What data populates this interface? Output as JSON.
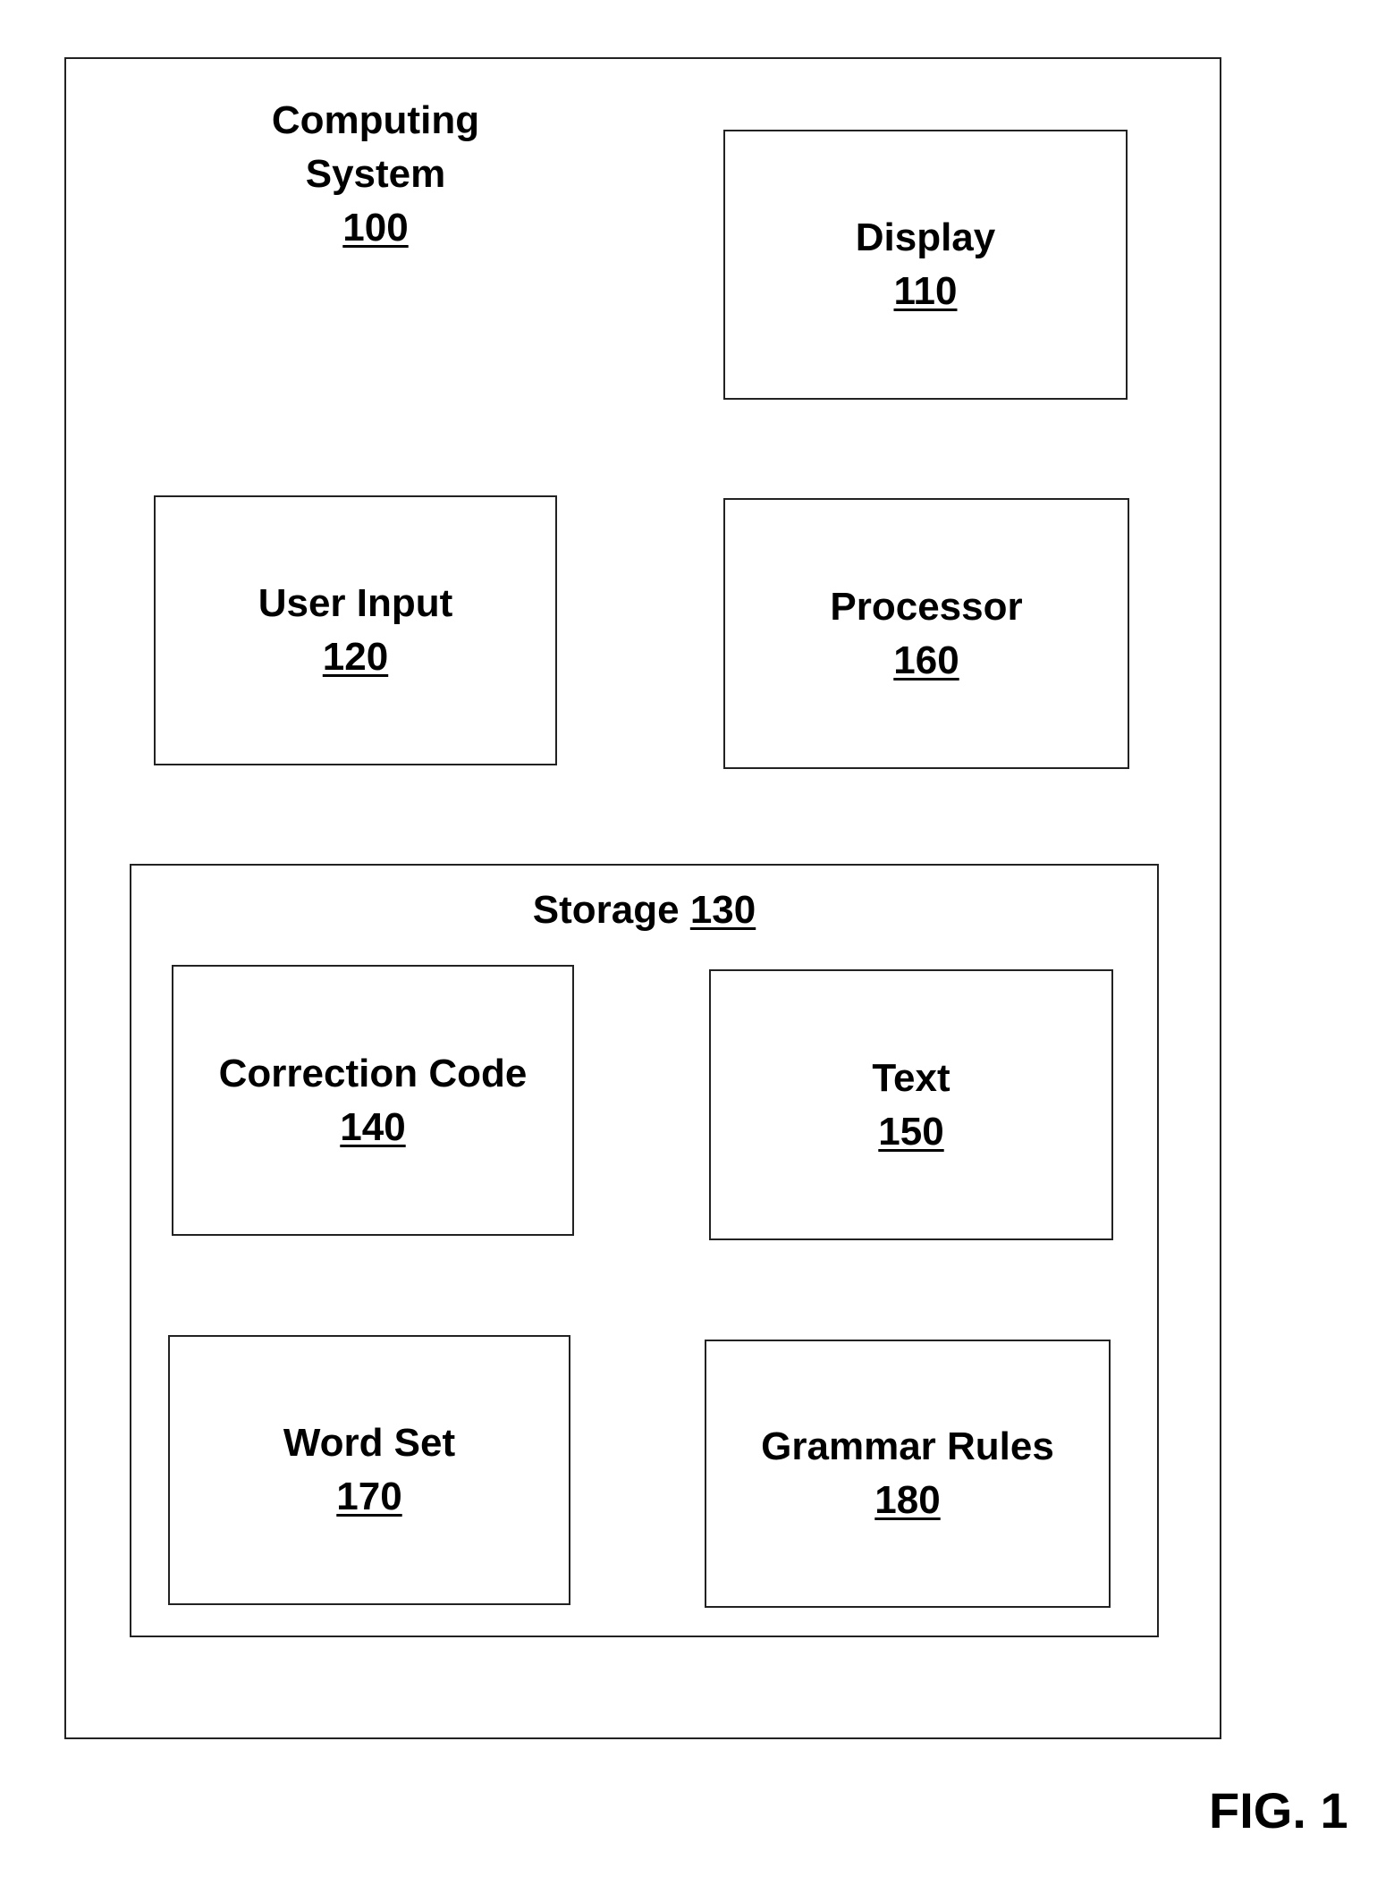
{
  "figure_label": "FIG. 1",
  "system": {
    "title_line1": "Computing",
    "title_line2": "System",
    "ref": "100"
  },
  "components": {
    "display": {
      "name": "Display",
      "ref": "110"
    },
    "user_input": {
      "name": "User Input",
      "ref": "120"
    },
    "processor": {
      "name": "Processor",
      "ref": "160"
    }
  },
  "storage": {
    "name": "Storage",
    "ref": "130",
    "items": {
      "correction_code": {
        "name": "Correction Code",
        "ref": "140"
      },
      "text": {
        "name": "Text",
        "ref": "150"
      },
      "word_set": {
        "name": "Word Set",
        "ref": "170"
      },
      "grammar_rules": {
        "name": "Grammar Rules",
        "ref": "180"
      }
    }
  }
}
